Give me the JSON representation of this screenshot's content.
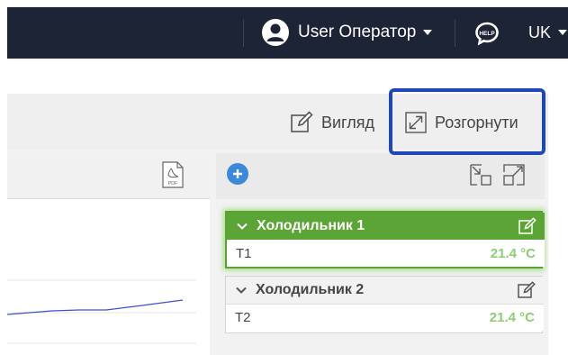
{
  "header": {
    "user_name": "User Оператор",
    "language": "UK",
    "help_label": "HELP"
  },
  "toolbar": {
    "view_label": "Вигляд",
    "expand_label": "Розгорнути"
  },
  "chart_panel": {
    "export_icon_label": "PDF"
  },
  "fridges": [
    {
      "name": "Холодильник 1",
      "sensor": "T1",
      "temperature": "21.4 °C",
      "active": true
    },
    {
      "name": "Холодильник 2",
      "sensor": "T2",
      "temperature": "21.4 °C",
      "active": false
    }
  ],
  "colors": {
    "topbar": "#1d2435",
    "active_green": "#5aa535",
    "temperature_green": "#8ccf6e",
    "highlight_blue": "#1e48b8",
    "add_blue": "#3a8ad9",
    "chart_line": "#3d4fd0"
  }
}
